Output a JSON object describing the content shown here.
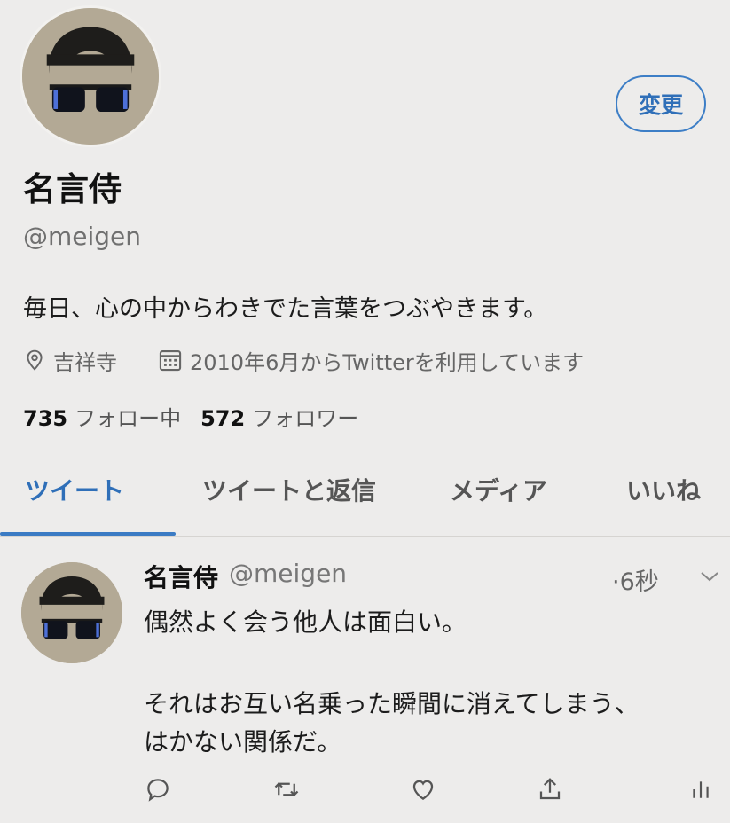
{
  "profile": {
    "display_name": "名言侍",
    "handle": "@meigen",
    "bio": "毎日、心の中からわきでた言葉をつぶやきます。",
    "location": "吉祥寺",
    "joined": "2010年6月からTwitterを利用しています",
    "following_count": "735",
    "following_label": "フォロー中",
    "followers_count": "572",
    "followers_label": "フォロワー",
    "edit_label": "変更"
  },
  "tabs": [
    {
      "label": "ツイート",
      "active": true
    },
    {
      "label": "ツイートと返信",
      "active": false
    },
    {
      "label": "メディア",
      "active": false
    },
    {
      "label": "いいね",
      "active": false
    }
  ],
  "tweet": {
    "name": "名言侍",
    "handle": "@meigen",
    "time": "·6秒",
    "lines": [
      "偶然よく会う他人は面白い。",
      "それはお互い名乗った瞬間に消えてしまう、",
      "はかない関係だ。"
    ]
  },
  "colors": {
    "accent": "#2f6fb8",
    "background": "#edeceb",
    "text": "#1a1a1a",
    "muted": "#666666"
  },
  "icons": [
    "location-pin-icon",
    "calendar-icon",
    "chevron-down-icon",
    "reply-icon",
    "retweet-icon",
    "like-icon",
    "share-icon",
    "analytics-icon"
  ]
}
